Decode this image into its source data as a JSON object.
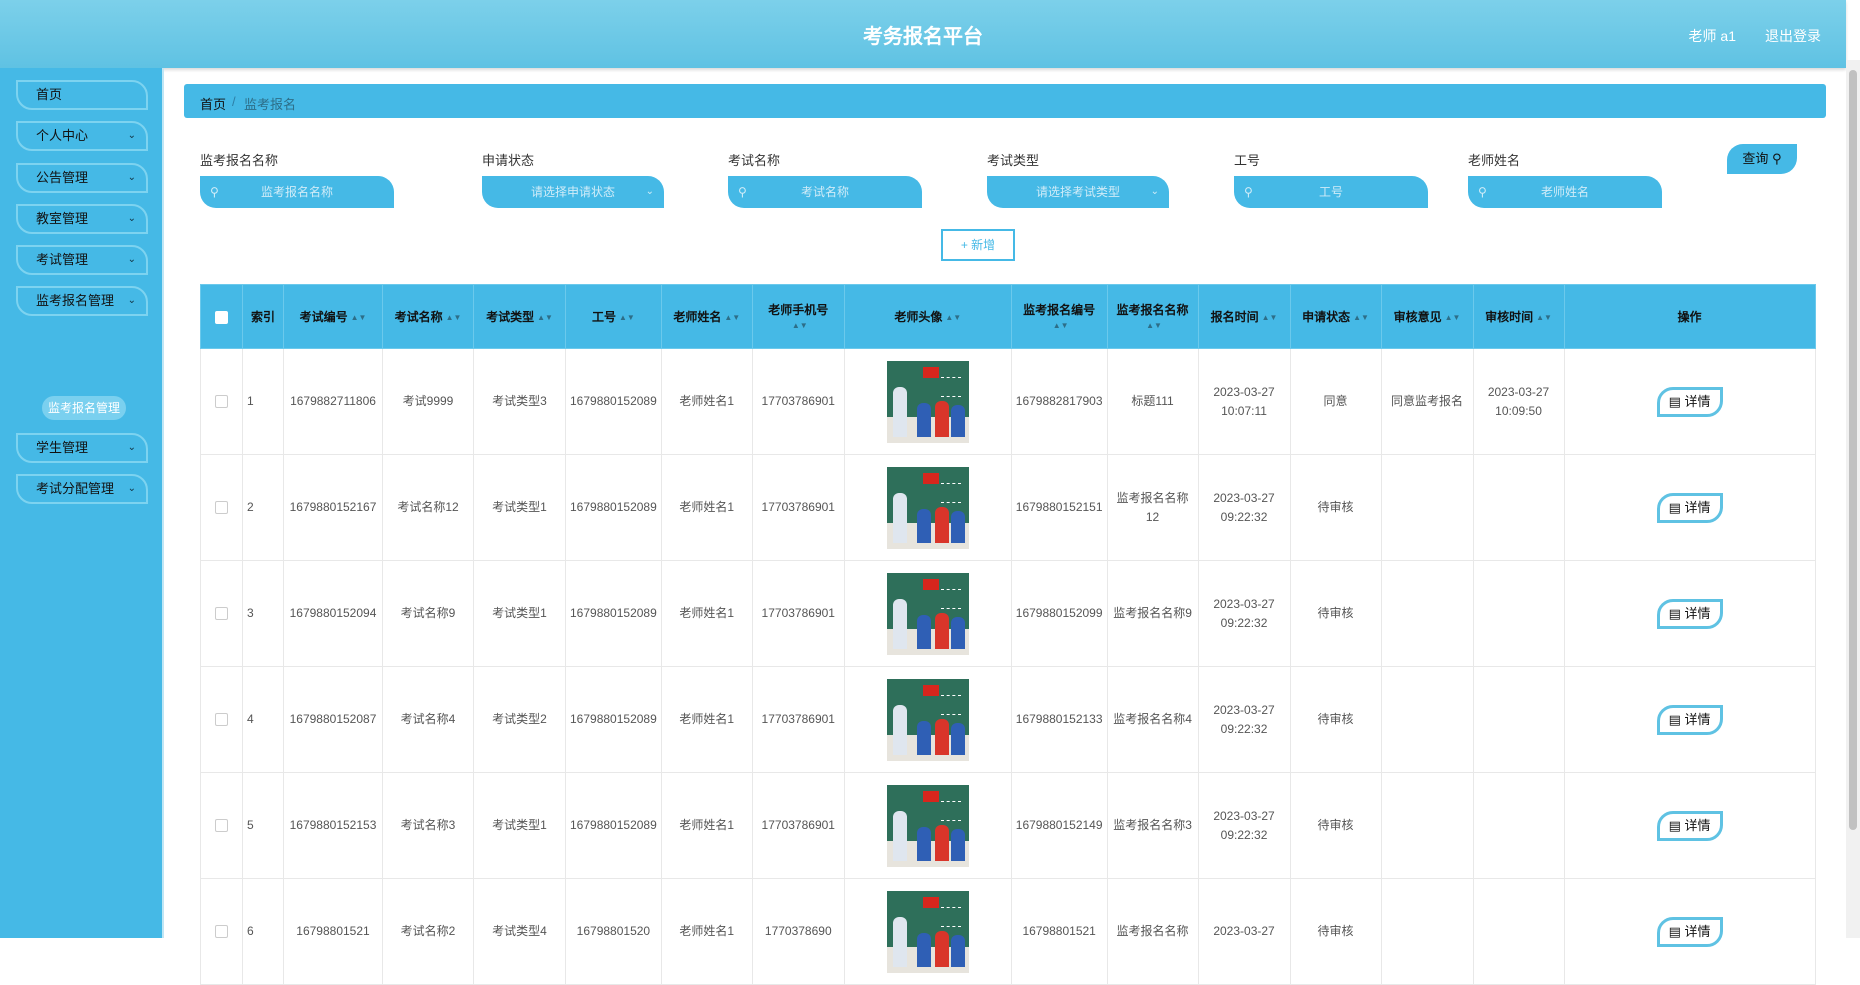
{
  "header": {
    "title": "考务报名平台",
    "user": "老师 a1",
    "logout": "退出登录"
  },
  "sidebar": {
    "items": [
      {
        "label": "首页",
        "has_children": false
      },
      {
        "label": "个人中心",
        "has_children": true
      },
      {
        "label": "公告管理",
        "has_children": true
      },
      {
        "label": "教室管理",
        "has_children": true
      },
      {
        "label": "考试管理",
        "has_children": true
      },
      {
        "label": "监考报名管理",
        "has_children": true
      },
      {
        "label": "学生管理",
        "has_children": true
      },
      {
        "label": "考试分配管理",
        "has_children": true
      }
    ],
    "active_sub": "监考报名管理"
  },
  "breadcrumb": {
    "home": "首页",
    "separator": "/",
    "current": "监考报名"
  },
  "search": {
    "fields": [
      {
        "label": "监考报名名称",
        "placeholder": "监考报名名称",
        "type": "input"
      },
      {
        "label": "申请状态",
        "placeholder": "请选择申请状态",
        "type": "select"
      },
      {
        "label": "考试名称",
        "placeholder": "考试名称",
        "type": "input"
      },
      {
        "label": "考试类型",
        "placeholder": "请选择考试类型",
        "type": "select"
      },
      {
        "label": "工号",
        "placeholder": "工号",
        "type": "input"
      },
      {
        "label": "老师姓名",
        "placeholder": "老师姓名",
        "type": "input"
      }
    ],
    "query_label": "查询",
    "add_label": "+ 新增"
  },
  "table": {
    "headers": [
      "索引",
      "考试编号",
      "考试名称",
      "考试类型",
      "工号",
      "老师姓名",
      "老师手机号",
      "老师头像",
      "监考报名编号",
      "监考报名名称",
      "报名时间",
      "申请状态",
      "审核意见",
      "审核时间",
      "操作"
    ],
    "detail_label": "详情",
    "rows": [
      {
        "index": "1",
        "exam_no": "1679882711806",
        "exam_name": "考试9999",
        "exam_type": "考试类型3",
        "job_no": "1679880152089",
        "teacher": "老师姓名1",
        "phone": "17703786901",
        "reg_no": "1679882817903",
        "reg_name": "标题111",
        "reg_time": "2023-03-27 10:07:11",
        "status": "同意",
        "opinion": "同意监考报名",
        "review_time": "2023-03-27 10:09:50"
      },
      {
        "index": "2",
        "exam_no": "1679880152167",
        "exam_name": "考试名称12",
        "exam_type": "考试类型1",
        "job_no": "1679880152089",
        "teacher": "老师姓名1",
        "phone": "17703786901",
        "reg_no": "1679880152151",
        "reg_name": "监考报名名称12",
        "reg_time": "2023-03-27 09:22:32",
        "status": "待审核",
        "opinion": "",
        "review_time": ""
      },
      {
        "index": "3",
        "exam_no": "1679880152094",
        "exam_name": "考试名称9",
        "exam_type": "考试类型1",
        "job_no": "1679880152089",
        "teacher": "老师姓名1",
        "phone": "17703786901",
        "reg_no": "1679880152099",
        "reg_name": "监考报名名称9",
        "reg_time": "2023-03-27 09:22:32",
        "status": "待审核",
        "opinion": "",
        "review_time": ""
      },
      {
        "index": "4",
        "exam_no": "1679880152087",
        "exam_name": "考试名称4",
        "exam_type": "考试类型2",
        "job_no": "1679880152089",
        "teacher": "老师姓名1",
        "phone": "17703786901",
        "reg_no": "1679880152133",
        "reg_name": "监考报名名称4",
        "reg_time": "2023-03-27 09:22:32",
        "status": "待审核",
        "opinion": "",
        "review_time": ""
      },
      {
        "index": "5",
        "exam_no": "1679880152153",
        "exam_name": "考试名称3",
        "exam_type": "考试类型1",
        "job_no": "1679880152089",
        "teacher": "老师姓名1",
        "phone": "17703786901",
        "reg_no": "1679880152149",
        "reg_name": "监考报名名称3",
        "reg_time": "2023-03-27 09:22:32",
        "status": "待审核",
        "opinion": "",
        "review_time": ""
      },
      {
        "index": "6",
        "exam_no": "16798801521",
        "exam_name": "考试名称2",
        "exam_type": "考试类型4",
        "job_no": "16798801520",
        "teacher": "老师姓名1",
        "phone": "1770378690",
        "reg_no": "16798801521",
        "reg_name": "监考报名名称",
        "reg_time": "2023-03-27",
        "status": "待审核",
        "opinion": "",
        "review_time": ""
      }
    ]
  }
}
